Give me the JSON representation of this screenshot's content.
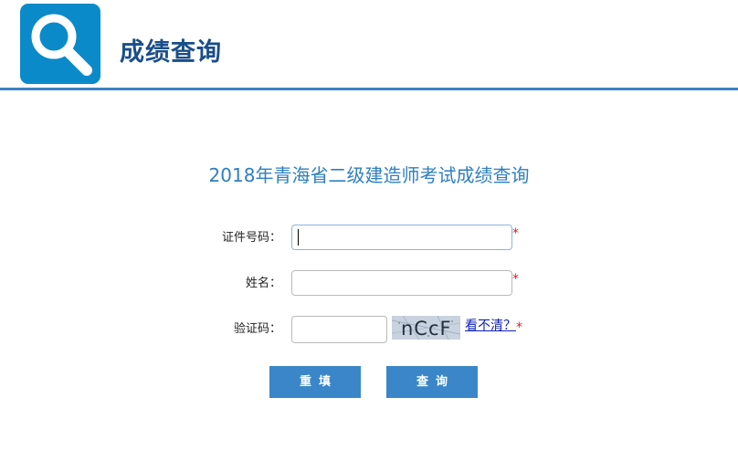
{
  "header": {
    "title": "成绩查询",
    "logo_icon": "search-icon",
    "accent_color": "#0b8ac9"
  },
  "main": {
    "title": "2018年青海省二级建造师考试成绩查询"
  },
  "form": {
    "id_label": "证件号码：",
    "name_label": "姓名：",
    "captcha_label": "验证码：",
    "required_mark": "*",
    "id_value": "",
    "name_value": "",
    "captcha_value": "",
    "captcha_text": "nCcF",
    "captcha_refresh": "看不清？"
  },
  "buttons": {
    "reset": "重填",
    "query": "查询",
    "color": "#3a86c8"
  }
}
